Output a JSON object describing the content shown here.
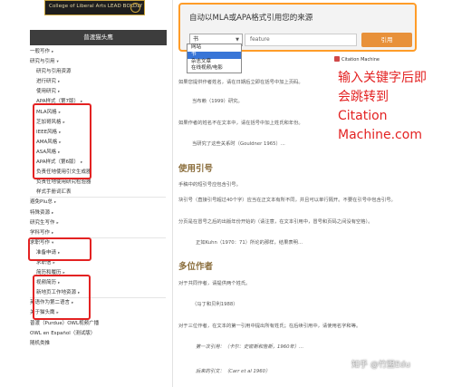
{
  "logo": {
    "text": "College of Liberal Arts  LEAD BOLDLY"
  },
  "sidebar": {
    "header": "普渡猫头鹰",
    "items": [
      {
        "label": "一般写作",
        "level": 1,
        "arrow": "▸"
      },
      {
        "label": "研究与引用",
        "level": 1,
        "arrow": "▾"
      },
      {
        "label": "研究与引用资源",
        "level": 2,
        "arrow": ""
      },
      {
        "label": "进行研究",
        "level": 2,
        "arrow": "▸"
      },
      {
        "label": "使用研究",
        "level": 2,
        "arrow": "▸"
      },
      {
        "label": "APA样式（第7版）",
        "level": 2,
        "arrow": "▸"
      },
      {
        "label": "MLA风格",
        "level": 2,
        "arrow": "▸"
      },
      {
        "label": "芝加哥风格",
        "level": 2,
        "arrow": "▸"
      },
      {
        "label": "IEEE风格",
        "level": 2,
        "arrow": "▸"
      },
      {
        "label": "AMA风格",
        "level": 2,
        "arrow": "▸"
      },
      {
        "label": "ASA风格",
        "level": 2,
        "arrow": "▸"
      },
      {
        "label": "APA样式（第6版）",
        "level": 2,
        "arrow": "▸"
      },
      {
        "label": "负责任地使用引文生成器",
        "level": 2,
        "arrow": ""
      },
      {
        "label": "负责任地使用研究检验器",
        "level": 2,
        "arrow": ""
      },
      {
        "label": "样式手册词汇表",
        "level": 2,
        "arrow": ""
      },
      {
        "label": "避免Plu总",
        "level": 1,
        "arrow": "▸"
      },
      {
        "label": "特殊资源",
        "level": 1,
        "arrow": "▸"
      },
      {
        "label": "研究生写作",
        "level": 1,
        "arrow": "▸"
      },
      {
        "label": "学科写作",
        "level": 1,
        "arrow": "▸"
      },
      {
        "label": "求职写作",
        "level": 1,
        "arrow": "▾"
      },
      {
        "label": "准备申请",
        "level": 2,
        "arrow": "▸"
      },
      {
        "label": "求职信",
        "level": 2,
        "arrow": "▸"
      },
      {
        "label": "简历和履历",
        "level": 2,
        "arrow": "▸"
      },
      {
        "label": "视频简历",
        "level": 2,
        "arrow": "▸"
      },
      {
        "label": "新地页工作地资源",
        "level": 2,
        "arrow": "▸"
      },
      {
        "label": "英语作为第二语言",
        "level": 1,
        "arrow": "▸"
      },
      {
        "label": "关于猫头鹰",
        "level": 1,
        "arrow": "▸"
      },
      {
        "label": "普渡（Purdue）OWL视频广播",
        "level": 1,
        "arrow": ""
      },
      {
        "label": "OWL en Español（测试版）",
        "level": 1,
        "arrow": ""
      },
      {
        "label": "随机类推",
        "level": 1,
        "arrow": ""
      }
    ]
  },
  "citation_widget": {
    "title": "自动以MLA或APA格式引用您的来源",
    "source_type": "书",
    "query": "feature",
    "button_label": "引用",
    "options": [
      {
        "label": "网站",
        "active": false
      },
      {
        "label": "书",
        "active": true
      },
      {
        "label": "杂志文章",
        "active": false
      },
      {
        "label": "在线视频/电影",
        "active": false
      }
    ]
  },
  "badge": {
    "text": "Citation Machine"
  },
  "annotation": [
    "输入关键字后即",
    "会跳转到",
    "Citation",
    "Machine.com"
  ],
  "content": {
    "para1": "如果您提供作者姓名，请在日期后立即在括号中加上页码。",
    "quote1": "当布赖（1999）研究。",
    "para2": "如果作者的姓名不在文本中，请在括号中加上姓氏和年份。",
    "quote2": "当研究了这些关系时（Gouldner 1965）...",
    "heading1": "使用引号",
    "para3": "手稿中的短引号应包含引号。",
    "para4": "块引号（直接引号超过40个字）应当在正文本有所不同，并且可以单行隔开。不要在引号中包含引号。",
    "para5": "分页是在冒号之后的出版年份开始的（请注意，在文本引用中，冒号和页码之间没有空格）。",
    "quote3": "正如Kuhn（1970：71）所论的那样，结果表明...",
    "heading2": "多位作者",
    "para6": "对于共同作者，请提供两个姓氏。",
    "quote4": "（马丁和贝利1988）",
    "para7": "对于三位作者，在文本的第一引用中提出所有姓氏；在后续引用中，请使用名字和等。",
    "quote5": "第一次引用：（卡尔：史密斯和詹斯，1960年）...",
    "quote6": "后来的引文：（Carr et al 1960）"
  },
  "watermark": "知乎 @竹盟Edu"
}
